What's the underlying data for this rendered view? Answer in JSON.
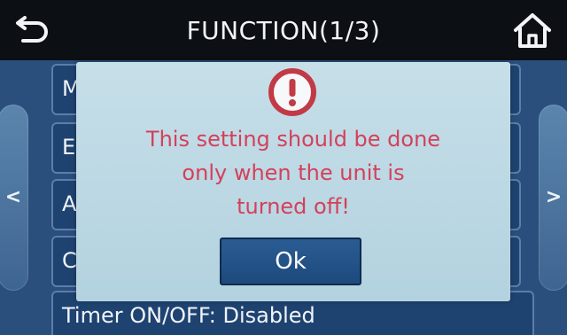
{
  "header": {
    "title": "FUNCTION(1/3)",
    "back_icon": "back-arrow-icon",
    "home_icon": "home-icon"
  },
  "list": {
    "items": [
      {
        "label": "M"
      },
      {
        "label": "E"
      },
      {
        "label": "A"
      },
      {
        "label": "C"
      },
      {
        "label": "Timer ON/OFF: Disabled"
      }
    ]
  },
  "nav": {
    "left_arrow": "<",
    "right_arrow": ">"
  },
  "dialog": {
    "icon": "warning-exclamation-icon",
    "message_line1": "This setting should be done",
    "message_line2": "only when the unit is",
    "message_line3": "turned off!",
    "ok_label": "Ok"
  },
  "colors": {
    "header_bg": "#0c0f14",
    "screen_bg": "#2a4f7c",
    "dialog_bg": "#c6dfe9",
    "message_text": "#d4405a",
    "ok_button": "#2a5c93"
  }
}
